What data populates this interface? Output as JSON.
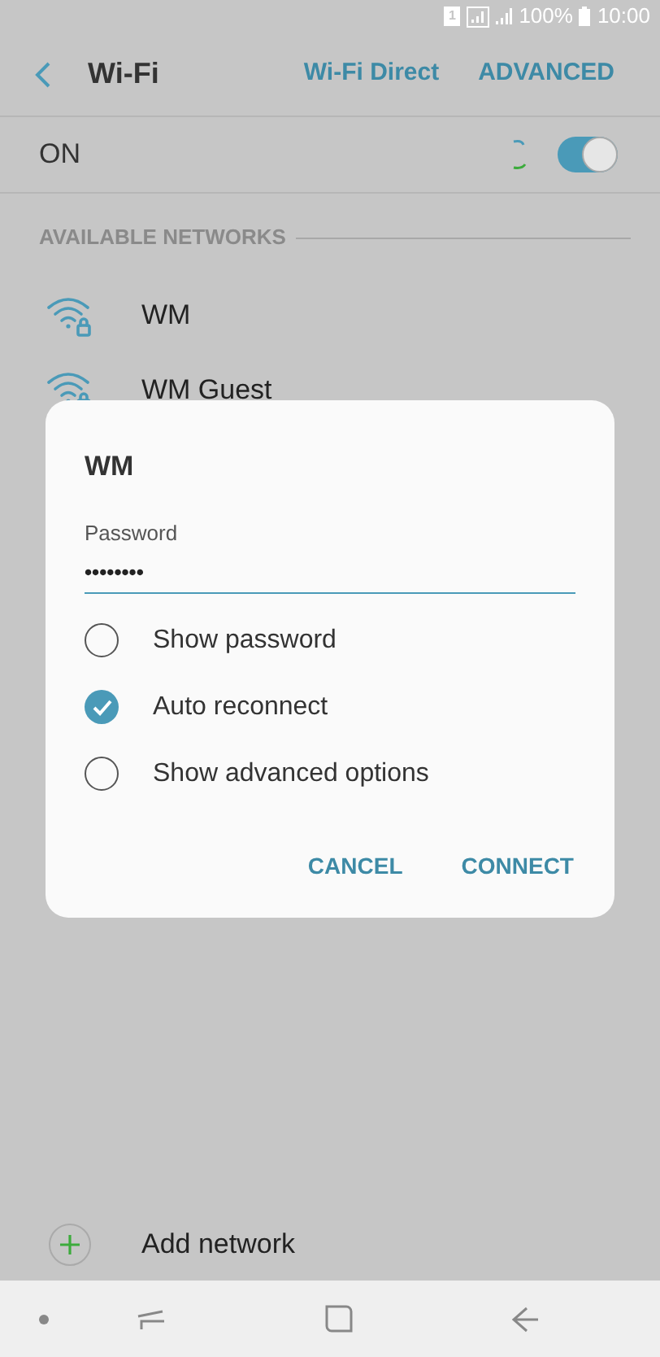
{
  "status_bar": {
    "sim": "1",
    "battery": "100%",
    "time": "10:00"
  },
  "header": {
    "title": "Wi-Fi",
    "actions": [
      "Wi-Fi Direct",
      "ADVANCED"
    ]
  },
  "master_switch": {
    "label": "ON",
    "on": true
  },
  "section": "AVAILABLE NETWORKS",
  "networks": [
    {
      "name": "WM"
    },
    {
      "name": "WM Guest"
    }
  ],
  "dialog": {
    "title": "WM",
    "field_label": "Password",
    "value": "••••••••",
    "options": [
      {
        "label": "Show password",
        "checked": false
      },
      {
        "label": "Auto reconnect",
        "checked": true
      },
      {
        "label": "Show advanced options",
        "checked": false
      }
    ],
    "buttons": [
      "CANCEL",
      "CONNECT"
    ]
  },
  "add_network": "Add network"
}
